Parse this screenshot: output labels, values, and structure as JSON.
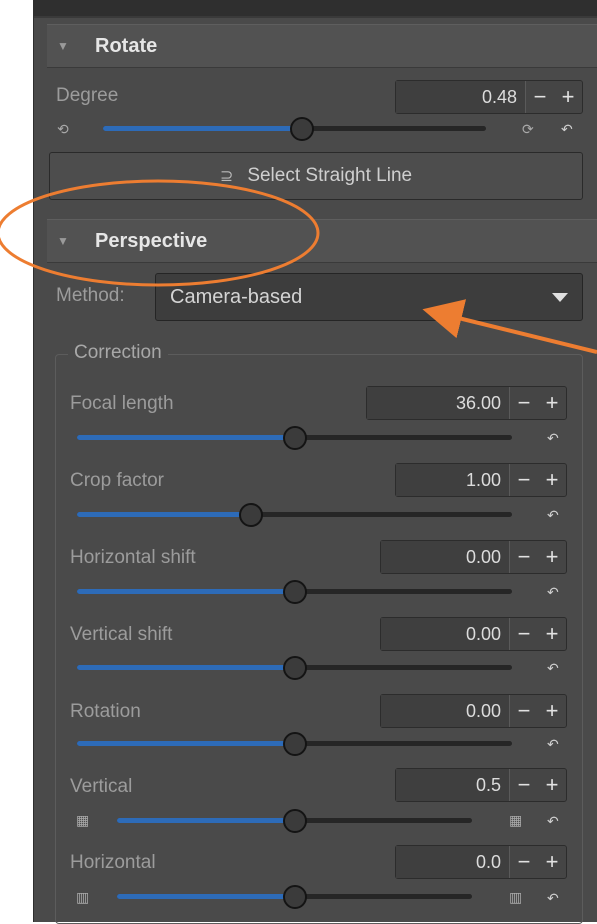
{
  "rotate": {
    "title": "Rotate",
    "degree_label": "Degree",
    "degree_value": "0.48",
    "degree_slider_fraction": 0.52,
    "select_button_label": "Select Straight Line"
  },
  "perspective": {
    "title": "Perspective",
    "method_label": "Method:",
    "method_value": "Camera-based",
    "correction_label": "Correction",
    "controls": [
      {
        "label": "Focal length",
        "value": "36.00",
        "fraction": 0.5
      },
      {
        "label": "Crop factor",
        "value": "1.00",
        "fraction": 0.4
      },
      {
        "label": "Horizontal shift",
        "value": "0.00",
        "fraction": 0.5
      },
      {
        "label": "Vertical shift",
        "value": "0.00",
        "fraction": 0.5
      },
      {
        "label": "Rotation",
        "value": "0.00",
        "fraction": 0.5
      },
      {
        "label": "Vertical",
        "value": "0.5",
        "fraction": 0.5
      },
      {
        "label": "Horizontal",
        "value": "0.0",
        "fraction": 0.5
      }
    ]
  },
  "buttons": {
    "minus": "−",
    "plus": "+"
  },
  "annotation_color": "#ed7d31",
  "slider_color": "#2d6bb8",
  "icons": {
    "collapse": "triangle-down-icon",
    "reset": "reset-arrow-icon",
    "rotate_ccw": "rotate-ccw-icon",
    "rotate_cw": "rotate-cw-icon",
    "line": "straight-line-icon",
    "dropdown": "chevron-down-icon"
  }
}
